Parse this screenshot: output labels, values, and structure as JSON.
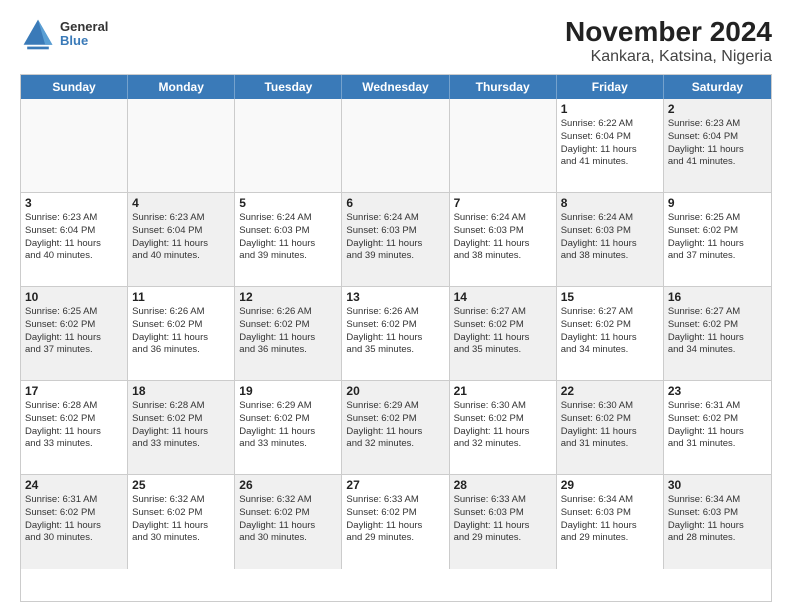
{
  "header": {
    "logo": {
      "line1": "General",
      "line2": "Blue"
    },
    "title": "November 2024",
    "subtitle": "Kankara, Katsina, Nigeria"
  },
  "weekdays": [
    "Sunday",
    "Monday",
    "Tuesday",
    "Wednesday",
    "Thursday",
    "Friday",
    "Saturday"
  ],
  "rows": [
    [
      {
        "day": "",
        "info": "",
        "empty": true
      },
      {
        "day": "",
        "info": "",
        "empty": true
      },
      {
        "day": "",
        "info": "",
        "empty": true
      },
      {
        "day": "",
        "info": "",
        "empty": true
      },
      {
        "day": "",
        "info": "",
        "empty": true
      },
      {
        "day": "1",
        "info": "Sunrise: 6:22 AM\nSunset: 6:04 PM\nDaylight: 11 hours\nand 41 minutes."
      },
      {
        "day": "2",
        "info": "Sunrise: 6:23 AM\nSunset: 6:04 PM\nDaylight: 11 hours\nand 41 minutes.",
        "shaded": true
      }
    ],
    [
      {
        "day": "3",
        "info": "Sunrise: 6:23 AM\nSunset: 6:04 PM\nDaylight: 11 hours\nand 40 minutes."
      },
      {
        "day": "4",
        "info": "Sunrise: 6:23 AM\nSunset: 6:04 PM\nDaylight: 11 hours\nand 40 minutes.",
        "shaded": true
      },
      {
        "day": "5",
        "info": "Sunrise: 6:24 AM\nSunset: 6:03 PM\nDaylight: 11 hours\nand 39 minutes."
      },
      {
        "day": "6",
        "info": "Sunrise: 6:24 AM\nSunset: 6:03 PM\nDaylight: 11 hours\nand 39 minutes.",
        "shaded": true
      },
      {
        "day": "7",
        "info": "Sunrise: 6:24 AM\nSunset: 6:03 PM\nDaylight: 11 hours\nand 38 minutes."
      },
      {
        "day": "8",
        "info": "Sunrise: 6:24 AM\nSunset: 6:03 PM\nDaylight: 11 hours\nand 38 minutes.",
        "shaded": true
      },
      {
        "day": "9",
        "info": "Sunrise: 6:25 AM\nSunset: 6:02 PM\nDaylight: 11 hours\nand 37 minutes."
      }
    ],
    [
      {
        "day": "10",
        "info": "Sunrise: 6:25 AM\nSunset: 6:02 PM\nDaylight: 11 hours\nand 37 minutes.",
        "shaded": true
      },
      {
        "day": "11",
        "info": "Sunrise: 6:26 AM\nSunset: 6:02 PM\nDaylight: 11 hours\nand 36 minutes."
      },
      {
        "day": "12",
        "info": "Sunrise: 6:26 AM\nSunset: 6:02 PM\nDaylight: 11 hours\nand 36 minutes.",
        "shaded": true
      },
      {
        "day": "13",
        "info": "Sunrise: 6:26 AM\nSunset: 6:02 PM\nDaylight: 11 hours\nand 35 minutes."
      },
      {
        "day": "14",
        "info": "Sunrise: 6:27 AM\nSunset: 6:02 PM\nDaylight: 11 hours\nand 35 minutes.",
        "shaded": true
      },
      {
        "day": "15",
        "info": "Sunrise: 6:27 AM\nSunset: 6:02 PM\nDaylight: 11 hours\nand 34 minutes."
      },
      {
        "day": "16",
        "info": "Sunrise: 6:27 AM\nSunset: 6:02 PM\nDaylight: 11 hours\nand 34 minutes.",
        "shaded": true
      }
    ],
    [
      {
        "day": "17",
        "info": "Sunrise: 6:28 AM\nSunset: 6:02 PM\nDaylight: 11 hours\nand 33 minutes."
      },
      {
        "day": "18",
        "info": "Sunrise: 6:28 AM\nSunset: 6:02 PM\nDaylight: 11 hours\nand 33 minutes.",
        "shaded": true
      },
      {
        "day": "19",
        "info": "Sunrise: 6:29 AM\nSunset: 6:02 PM\nDaylight: 11 hours\nand 33 minutes."
      },
      {
        "day": "20",
        "info": "Sunrise: 6:29 AM\nSunset: 6:02 PM\nDaylight: 11 hours\nand 32 minutes.",
        "shaded": true
      },
      {
        "day": "21",
        "info": "Sunrise: 6:30 AM\nSunset: 6:02 PM\nDaylight: 11 hours\nand 32 minutes."
      },
      {
        "day": "22",
        "info": "Sunrise: 6:30 AM\nSunset: 6:02 PM\nDaylight: 11 hours\nand 31 minutes.",
        "shaded": true
      },
      {
        "day": "23",
        "info": "Sunrise: 6:31 AM\nSunset: 6:02 PM\nDaylight: 11 hours\nand 31 minutes."
      }
    ],
    [
      {
        "day": "24",
        "info": "Sunrise: 6:31 AM\nSunset: 6:02 PM\nDaylight: 11 hours\nand 30 minutes.",
        "shaded": true
      },
      {
        "day": "25",
        "info": "Sunrise: 6:32 AM\nSunset: 6:02 PM\nDaylight: 11 hours\nand 30 minutes."
      },
      {
        "day": "26",
        "info": "Sunrise: 6:32 AM\nSunset: 6:02 PM\nDaylight: 11 hours\nand 30 minutes.",
        "shaded": true
      },
      {
        "day": "27",
        "info": "Sunrise: 6:33 AM\nSunset: 6:02 PM\nDaylight: 11 hours\nand 29 minutes."
      },
      {
        "day": "28",
        "info": "Sunrise: 6:33 AM\nSunset: 6:03 PM\nDaylight: 11 hours\nand 29 minutes.",
        "shaded": true
      },
      {
        "day": "29",
        "info": "Sunrise: 6:34 AM\nSunset: 6:03 PM\nDaylight: 11 hours\nand 29 minutes."
      },
      {
        "day": "30",
        "info": "Sunrise: 6:34 AM\nSunset: 6:03 PM\nDaylight: 11 hours\nand 28 minutes.",
        "shaded": true
      }
    ]
  ]
}
